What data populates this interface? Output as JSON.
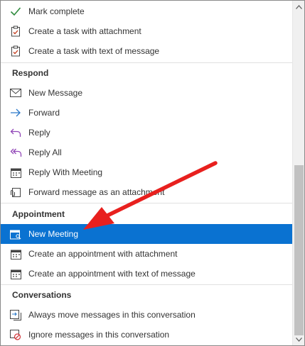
{
  "task_items": [
    {
      "label": "Mark complete",
      "icon": "checkmark-icon"
    },
    {
      "label": "Create a task with attachment",
      "icon": "task-clipboard-icon"
    },
    {
      "label": "Create a task with text of message",
      "icon": "task-clipboard-icon"
    }
  ],
  "respond": {
    "header": "Respond",
    "items": [
      {
        "label": "New Message",
        "icon": "envelope-icon"
      },
      {
        "label": "Forward",
        "icon": "forward-arrow-icon"
      },
      {
        "label": "Reply",
        "icon": "reply-arrow-icon"
      },
      {
        "label": "Reply All",
        "icon": "reply-all-arrow-icon"
      },
      {
        "label": "Reply With Meeting",
        "icon": "calendar-icon"
      },
      {
        "label": "Forward message as an attachment",
        "icon": "forward-attachment-icon"
      }
    ]
  },
  "appointment": {
    "header": "Appointment",
    "items": [
      {
        "label": "New Meeting",
        "icon": "calendar-people-icon",
        "selected": true
      },
      {
        "label": "Create an appointment with attachment",
        "icon": "calendar-icon"
      },
      {
        "label": "Create an appointment with text of message",
        "icon": "calendar-icon"
      }
    ]
  },
  "conversations": {
    "header": "Conversations",
    "items": [
      {
        "label": "Always move messages in this conversation",
        "icon": "move-conversation-icon"
      },
      {
        "label": "Ignore messages in this conversation",
        "icon": "ignore-conversation-icon"
      }
    ]
  },
  "colors": {
    "selected_bg": "#0a72d1",
    "annotation_arrow": "#e8201e",
    "check_green": "#2e8b3d",
    "forward_blue": "#2b79c9",
    "reply_purple": "#9146b7",
    "ignore_red": "#d13438"
  }
}
